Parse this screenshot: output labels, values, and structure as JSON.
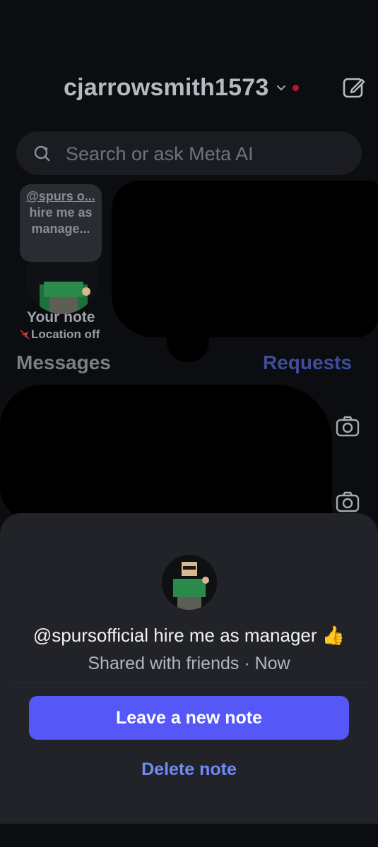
{
  "header": {
    "username": "cjarrowsmith1573",
    "chevron_icon": "chevron-down-icon",
    "status_dot_color": "#b3192c",
    "compose_icon": "compose-icon"
  },
  "search": {
    "placeholder": "Search or ask Meta AI",
    "icon": "meta-ai-search-icon"
  },
  "note": {
    "bubble_handle": "@spurs o...",
    "bubble_text": "hire me as manage...",
    "label": "Your note",
    "location": "Location off"
  },
  "sections": {
    "messages": "Messages",
    "requests": "Requests"
  },
  "sheet": {
    "note_text": "@spursofficial hire me as manager 👍",
    "meta": "Shared with friends · Now",
    "primary_button": "Leave a new note",
    "secondary_link": "Delete note"
  },
  "colors": {
    "background": "#0c0d10",
    "sheet": "#222328",
    "accent_button": "#5558f6",
    "link": "#6d8cf4",
    "requests": "#3d4d9b"
  }
}
